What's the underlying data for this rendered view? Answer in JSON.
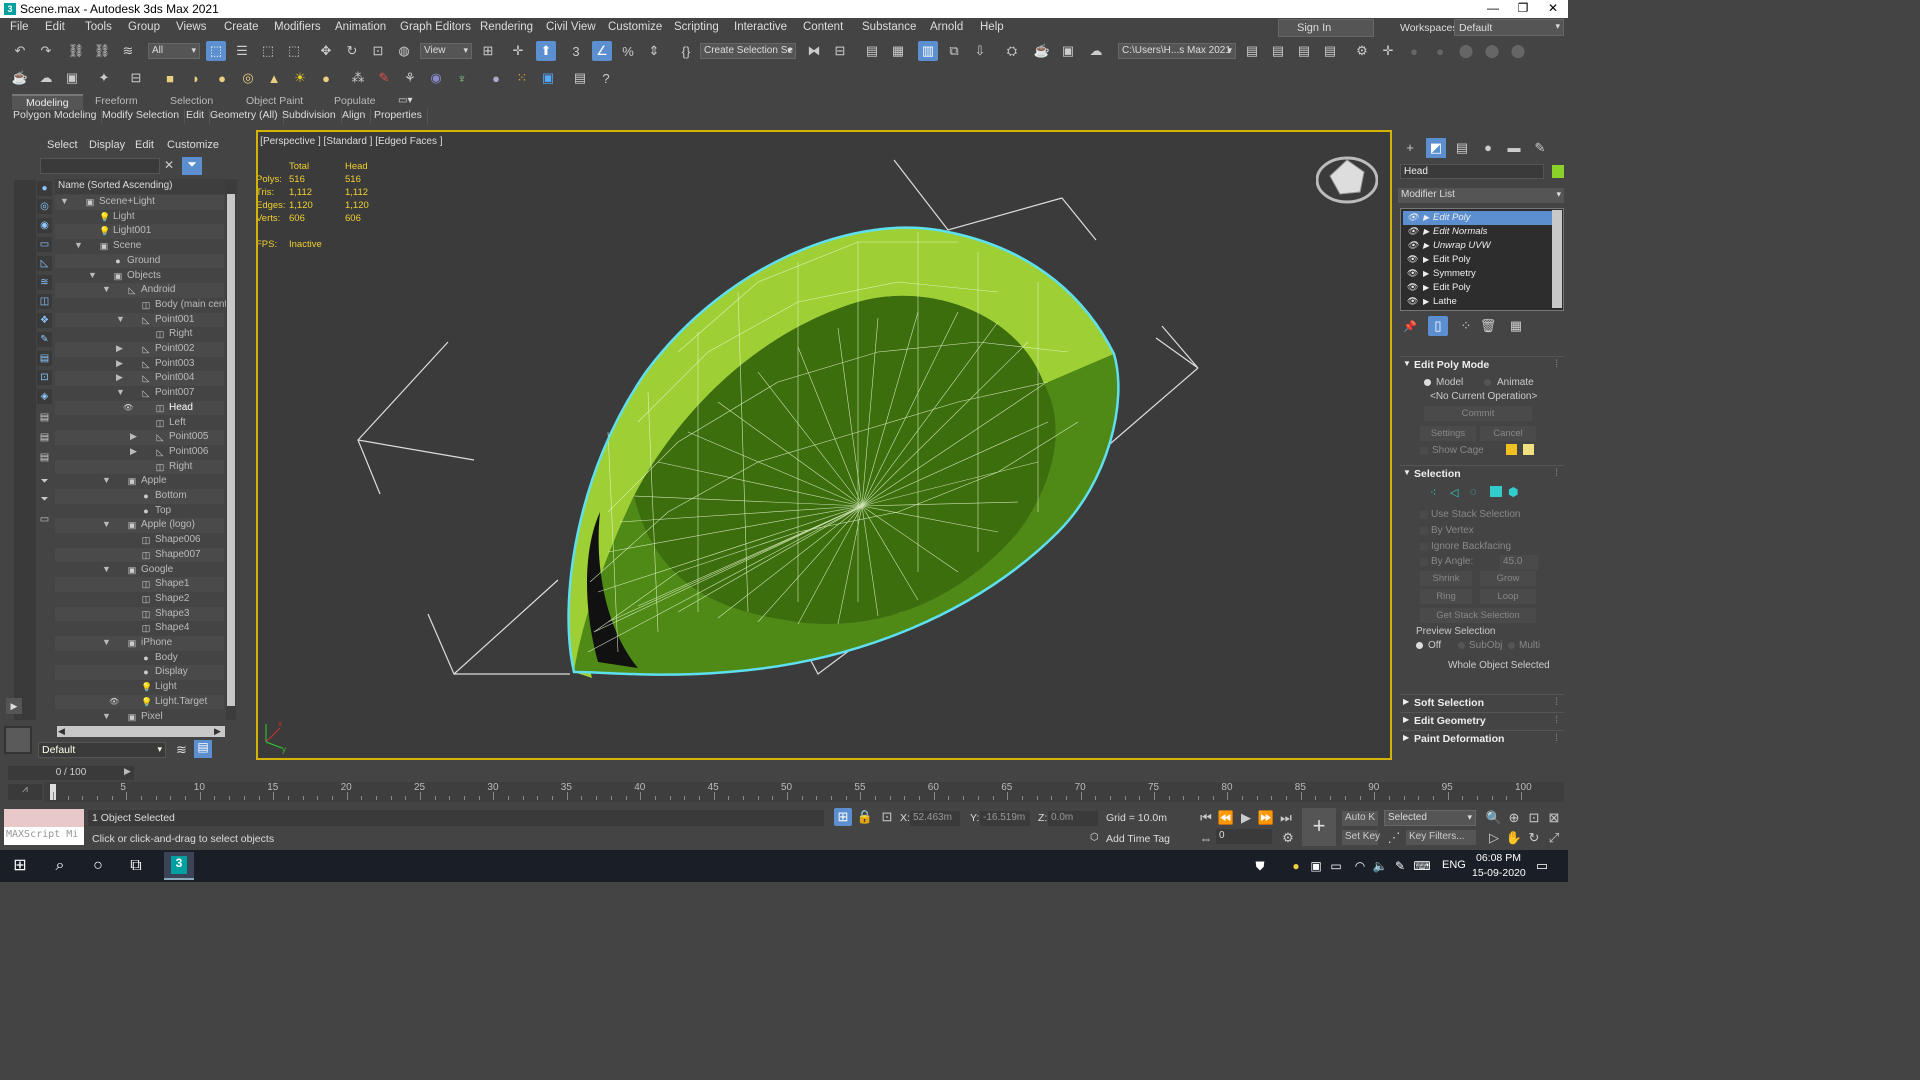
{
  "titlebar": {
    "title": "Scene.max - Autodesk 3ds Max 2021",
    "app_icon": "3"
  },
  "menu": [
    "File",
    "Edit",
    "Tools",
    "Group",
    "Views",
    "Create",
    "Modifiers",
    "Animation",
    "Graph Editors",
    "Rendering",
    "Civil View",
    "Customize",
    "Scripting",
    "Interactive",
    "Content",
    "Substance",
    "Arnold",
    "Help"
  ],
  "signin": "Sign In",
  "workspaces_label": "Workspaces:",
  "workspace": "Default",
  "toolbar": {
    "selection_filter": "All",
    "ref_coord": "View",
    "named_selection": "Create Selection Se",
    "project_path": "C:\\Users\\H...s Max 2021"
  },
  "ribbon": {
    "tabs": [
      "Modeling",
      "Freeform",
      "Selection",
      "Object Paint",
      "Populate"
    ],
    "active_tab": "Modeling",
    "subtabs": [
      "Polygon Modeling",
      "Modify Selection",
      "Edit",
      "Geometry (All)",
      "Subdivision",
      "Align",
      "Properties"
    ]
  },
  "explorer": {
    "menus": [
      "Select",
      "Display",
      "Edit",
      "Customize"
    ],
    "header": "Name (Sorted Ascending)",
    "layer": "Default",
    "rows": [
      {
        "label": "Scene+Light",
        "depth": 0,
        "arrow": "▼",
        "icon": "▣"
      },
      {
        "label": "Light",
        "depth": 1,
        "arrow": "",
        "icon": "💡"
      },
      {
        "label": "Light001",
        "depth": 1,
        "arrow": "",
        "icon": "💡"
      },
      {
        "label": "Scene",
        "depth": 1,
        "arrow": "▼",
        "icon": "▣"
      },
      {
        "label": "Ground",
        "depth": 2,
        "arrow": "",
        "icon": "●"
      },
      {
        "label": "Objects",
        "depth": 2,
        "arrow": "▼",
        "icon": "▣"
      },
      {
        "label": "Android",
        "depth": 3,
        "arrow": "▼",
        "icon": "◺"
      },
      {
        "label": "Body (main centr",
        "depth": 4,
        "arrow": "",
        "icon": "◫"
      },
      {
        "label": "Point001",
        "depth": 4,
        "arrow": "▼",
        "icon": "◺"
      },
      {
        "label": "Right",
        "depth": 5,
        "arrow": "",
        "icon": "◫"
      },
      {
        "label": "Point002",
        "depth": 4,
        "arrow": "▶",
        "icon": "◺"
      },
      {
        "label": "Point003",
        "depth": 4,
        "arrow": "▶",
        "icon": "◺"
      },
      {
        "label": "Point004",
        "depth": 4,
        "arrow": "▶",
        "icon": "◺"
      },
      {
        "label": "Point007",
        "depth": 4,
        "arrow": "▼",
        "icon": "◺"
      },
      {
        "label": "Head",
        "depth": 5,
        "arrow": "",
        "icon": "◫",
        "eye": true,
        "selected": true
      },
      {
        "label": "Left",
        "depth": 5,
        "arrow": "",
        "icon": "◫"
      },
      {
        "label": "Point005",
        "depth": 5,
        "arrow": "▶",
        "icon": "◺"
      },
      {
        "label": "Point006",
        "depth": 5,
        "arrow": "▶",
        "icon": "◺"
      },
      {
        "label": "Right",
        "depth": 5,
        "arrow": "",
        "icon": "◫"
      },
      {
        "label": "Apple",
        "depth": 3,
        "arrow": "▼",
        "icon": "▣"
      },
      {
        "label": "Bottom",
        "depth": 4,
        "arrow": "",
        "icon": "●"
      },
      {
        "label": "Top",
        "depth": 4,
        "arrow": "",
        "icon": "●"
      },
      {
        "label": "Apple (logo)",
        "depth": 3,
        "arrow": "▼",
        "icon": "▣"
      },
      {
        "label": "Shape006",
        "depth": 4,
        "arrow": "",
        "icon": "◫"
      },
      {
        "label": "Shape007",
        "depth": 4,
        "arrow": "",
        "icon": "◫"
      },
      {
        "label": "Google",
        "depth": 3,
        "arrow": "▼",
        "icon": "▣"
      },
      {
        "label": "Shape1",
        "depth": 4,
        "arrow": "",
        "icon": "◫"
      },
      {
        "label": "Shape2",
        "depth": 4,
        "arrow": "",
        "icon": "◫"
      },
      {
        "label": "Shape3",
        "depth": 4,
        "arrow": "",
        "icon": "◫"
      },
      {
        "label": "Shape4",
        "depth": 4,
        "arrow": "",
        "icon": "◫"
      },
      {
        "label": "iPhone",
        "depth": 3,
        "arrow": "▼",
        "icon": "▣"
      },
      {
        "label": "Body",
        "depth": 4,
        "arrow": "",
        "icon": "●"
      },
      {
        "label": "Display",
        "depth": 4,
        "arrow": "",
        "icon": "●"
      },
      {
        "label": "Light",
        "depth": 4,
        "arrow": "",
        "icon": "💡"
      },
      {
        "label": "Light.Target",
        "depth": 4,
        "arrow": "",
        "icon": "💡",
        "eye": true
      },
      {
        "label": "Pixel",
        "depth": 3,
        "arrow": "▼",
        "icon": "▣"
      }
    ]
  },
  "viewport": {
    "label": "[+] [Perspective ] [Standard ] [Edged Faces ]",
    "stats_header": {
      "total": "Total",
      "head": "Head"
    },
    "stats": [
      {
        "name": "Polys:",
        "total": "516",
        "head": "516"
      },
      {
        "name": "Tris:",
        "total": "1,112",
        "head": "1,112"
      },
      {
        "name": "Edges:",
        "total": "1,120",
        "head": "1,120"
      },
      {
        "name": "Verts:",
        "total": "606",
        "head": "606"
      }
    ],
    "fps_label": "FPS:",
    "fps_value": "Inactive",
    "mesh_color": "#8ad12a",
    "outline_color": "#5fe0f0"
  },
  "command_panel": {
    "object_name": "Head",
    "object_color": "#8ad12a",
    "modifier_list": "Modifier List",
    "stack": [
      {
        "label": "Edit Poly",
        "active": true,
        "italic": true
      },
      {
        "label": "Edit Normals",
        "italic": true
      },
      {
        "label": "Unwrap UVW",
        "italic": true
      },
      {
        "label": "Edit Poly"
      },
      {
        "label": "Symmetry"
      },
      {
        "label": "Edit Poly"
      },
      {
        "label": "Lathe"
      }
    ],
    "edit_poly_mode": {
      "title": "Edit Poly Mode",
      "model": "Model",
      "animate": "Animate",
      "operation": "<No Current Operation>",
      "commit": "Commit",
      "settings": "Settings",
      "cancel": "Cancel",
      "show_cage": "Show Cage"
    },
    "selection": {
      "title": "Selection",
      "use_stack": "Use Stack Selection",
      "by_vertex": "By Vertex",
      "ignore_backfacing": "Ignore Backfacing",
      "by_angle": "By Angle:",
      "angle": "45.0",
      "shrink": "Shrink",
      "grow": "Grow",
      "ring": "Ring",
      "loop": "Loop",
      "get_stack": "Get Stack Selection",
      "preview": "Preview Selection",
      "off": "Off",
      "subobj": "SubObj",
      "multi": "Multi",
      "whole": "Whole Object Selected"
    },
    "rollouts": [
      "Soft Selection",
      "Edit Geometry",
      "Paint Deformation"
    ]
  },
  "timeline": {
    "slider": "0 / 100",
    "ticks": [
      "0",
      "5",
      "10",
      "15",
      "20",
      "25",
      "30",
      "35",
      "40",
      "45",
      "50",
      "55",
      "60",
      "65",
      "70",
      "75",
      "80",
      "85",
      "90",
      "95",
      "100"
    ]
  },
  "status": {
    "maxscript": "MAXScript Mi",
    "selected": "1 Object Selected",
    "prompt": "Click or click-and-drag to select objects",
    "x_label": "X:",
    "x": "52.463m",
    "y_label": "Y:",
    "y": "-16.519m",
    "z_label": "Z:",
    "z": "0.0m",
    "grid": "Grid = 10.0m",
    "add_time_tag": "Add Time Tag",
    "autokey": "Auto K",
    "setkey": "Set Key",
    "selected_dd": "Selected",
    "key_filters": "Key Filters...",
    "frame": "0"
  },
  "taskbar": {
    "lang": "ENG",
    "time": "06:08 PM",
    "date": "15-09-2020"
  }
}
